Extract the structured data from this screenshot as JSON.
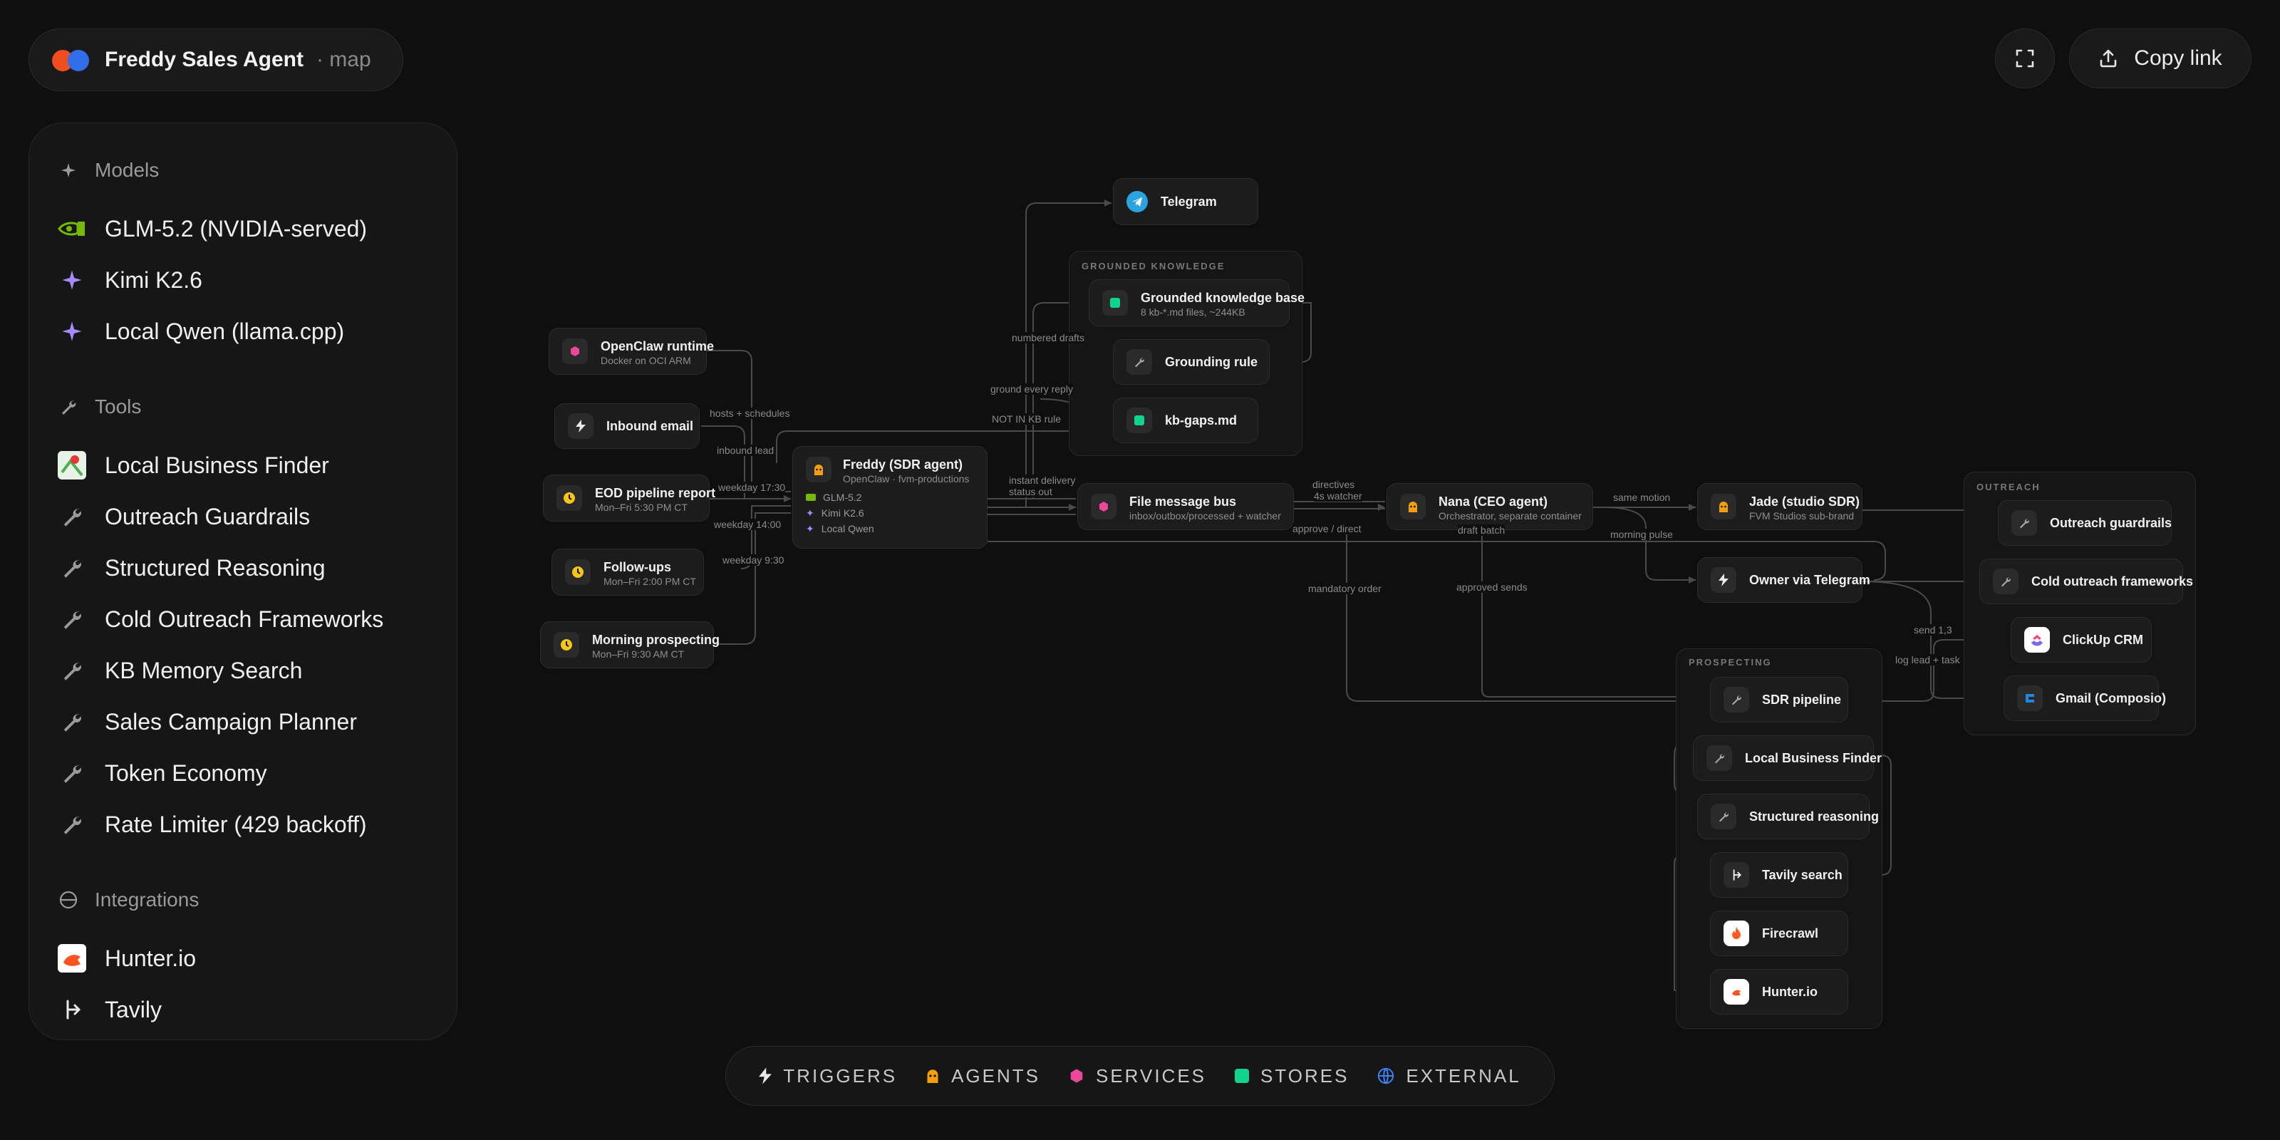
{
  "header": {
    "app_name": "Freddy Sales Agent",
    "app_sub": "· map",
    "copy_label": "Copy link"
  },
  "sidebar": {
    "models_title": "Models",
    "models": [
      {
        "label": "GLM-5.2 (NVIDIA-served)",
        "icon": "nvidia-icon"
      },
      {
        "label": "Kimi K2.6",
        "icon": "sparkle-icon"
      },
      {
        "label": "Local Qwen (llama.cpp)",
        "icon": "sparkle-icon"
      }
    ],
    "tools_title": "Tools",
    "tools": [
      {
        "label": "Local Business Finder",
        "icon": "map-icon"
      },
      {
        "label": "Outreach Guardrails",
        "icon": "wrench-icon"
      },
      {
        "label": "Structured Reasoning",
        "icon": "wrench-icon"
      },
      {
        "label": "Cold Outreach Frameworks",
        "icon": "wrench-icon"
      },
      {
        "label": "KB Memory Search",
        "icon": "wrench-icon"
      },
      {
        "label": "Sales Campaign Planner",
        "icon": "wrench-icon"
      },
      {
        "label": "Token Economy",
        "icon": "wrench-icon"
      },
      {
        "label": "Rate Limiter (429 backoff)",
        "icon": "wrench-icon"
      }
    ],
    "integrations_title": "Integrations",
    "integrations": [
      {
        "label": "Hunter.io",
        "icon": "hunter-icon"
      },
      {
        "label": "Tavily",
        "icon": "tavily-icon"
      }
    ]
  },
  "diagram": {
    "groups": {
      "grounded": "GROUNDED KNOWLEDGE",
      "outreach": "OUTREACH",
      "prospecting": "PROSPECTING"
    },
    "nodes": {
      "telegram": {
        "title": "Telegram"
      },
      "kb": {
        "title": "Grounded knowledge base",
        "sub": "8 kb-*.md files, ~244KB"
      },
      "grounding_rule": {
        "title": "Grounding rule"
      },
      "kb_gaps": {
        "title": "kb-gaps.md"
      },
      "openclaw": {
        "title": "OpenClaw runtime",
        "sub": "Docker on OCI ARM"
      },
      "inbound": {
        "title": "Inbound email"
      },
      "eod": {
        "title": "EOD pipeline report",
        "sub": "Mon–Fri 5:30 PM CT"
      },
      "followups": {
        "title": "Follow-ups",
        "sub": "Mon–Fri 2:00 PM CT"
      },
      "morning": {
        "title": "Morning prospecting",
        "sub": "Mon–Fri 9:30 AM CT"
      },
      "freddy": {
        "title": "Freddy (SDR agent)",
        "sub": "OpenClaw · fvm-productions",
        "models": [
          "GLM-5.2",
          "Kimi K2.6",
          "Local Qwen"
        ]
      },
      "bus": {
        "title": "File message bus",
        "sub": "inbox/outbox/processed + watcher"
      },
      "nana": {
        "title": "Nana (CEO agent)",
        "sub": "Orchestrator, separate container"
      },
      "jade": {
        "title": "Jade (studio SDR)",
        "sub": "FVM Studios sub-brand"
      },
      "owner": {
        "title": "Owner via Telegram"
      },
      "guardrails": {
        "title": "Outreach guardrails"
      },
      "frameworks": {
        "title": "Cold outreach frameworks"
      },
      "clickup": {
        "title": "ClickUp CRM"
      },
      "gmail": {
        "title": "Gmail (Composio)"
      },
      "sdr_pipeline": {
        "title": "SDR pipeline"
      },
      "lbf": {
        "title": "Local Business Finder"
      },
      "structured": {
        "title": "Structured reasoning"
      },
      "tavily": {
        "title": "Tavily search"
      },
      "firecrawl": {
        "title": "Firecrawl"
      },
      "hunter": {
        "title": "Hunter.io"
      }
    },
    "edge_labels": {
      "numbered_drafts": "numbered drafts",
      "ground_every_reply": "ground every reply",
      "not_in_kb": "NOT IN KB rule",
      "hosts": "hosts + schedules",
      "inbound_lead": "inbound lead",
      "weekday1730": "weekday 17:30",
      "weekday1400": "weekday 14:00",
      "weekday930": "weekday 9:30",
      "instant": "instant delivery",
      "status_out": "status out",
      "directives": "directives",
      "watcher": "4s watcher",
      "approve": "approve / direct",
      "draft_batch": "draft batch",
      "same_motion": "same motion",
      "morning_pulse": "morning pulse",
      "mandatory": "mandatory order",
      "approved_sends": "approved sends",
      "send": "send 1,3",
      "log_lead": "log lead + task"
    }
  },
  "legend": {
    "items": [
      {
        "label": "TRIGGERS",
        "color": "#e8e8e8"
      },
      {
        "label": "AGENTS",
        "color": "#f59e0b"
      },
      {
        "label": "SERVICES",
        "color": "#ec4899"
      },
      {
        "label": "STORES",
        "color": "#10d48e"
      },
      {
        "label": "EXTERNAL",
        "color": "#3b82f6"
      }
    ]
  }
}
